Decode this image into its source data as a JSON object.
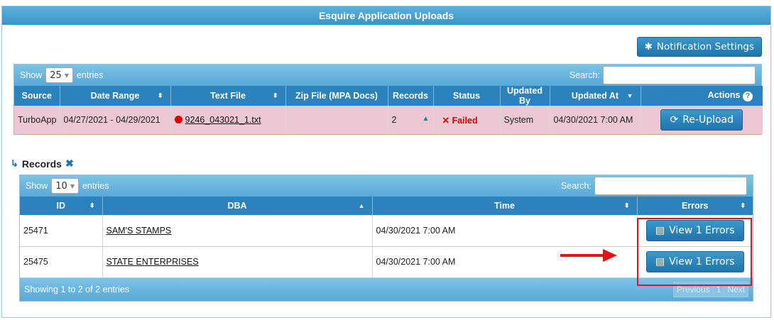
{
  "panel": {
    "title": "Esquire Application Uploads"
  },
  "notification_settings": {
    "icon": "gear-icon",
    "label": "Notification Settings"
  },
  "uploads_table": {
    "show_label": "Show",
    "page_length": "25",
    "entries_label": "entries",
    "search_label": "Search:",
    "search_value": "",
    "columns": [
      "Source",
      "Date Range",
      "Text File",
      "Zip File (MPA Docs)",
      "Records",
      "Status",
      "Updated By",
      "Updated At",
      "Actions"
    ],
    "rows": [
      {
        "source": "TurboApp",
        "date_range": "04/27/2021 - 04/29/2021",
        "text_file": "9246_043021_1.txt",
        "zip_file": "",
        "records": "2",
        "status": "Failed",
        "updated_by": "System",
        "updated_at": "04/30/2021 7:00 AM",
        "action_label": "Re-Upload"
      }
    ]
  },
  "records_section": {
    "title": "Records",
    "show_label": "Show",
    "page_length": "10",
    "entries_label": "entries",
    "search_label": "Search:",
    "search_value": "",
    "columns": [
      "ID",
      "DBA",
      "Time",
      "Errors"
    ],
    "rows": [
      {
        "id": "25471",
        "dba": "SAM'S STAMPS",
        "time": "04/30/2021 7:00 AM",
        "errors_label": "View 1 Errors"
      },
      {
        "id": "25475",
        "dba": "STATE ENTERPRISES",
        "time": "04/30/2021 7:00 AM",
        "errors_label": "View 1 Errors"
      }
    ],
    "footer_info": "Showing 1 to 2 of 2 entries",
    "pager": {
      "previous": "Previous",
      "page": "1",
      "next": "Next"
    }
  },
  "colors": {
    "accent": "#2c82bd",
    "failed_row": "#ebc8d4",
    "failed_text": "#d40000",
    "highlight": "#e0141c"
  }
}
